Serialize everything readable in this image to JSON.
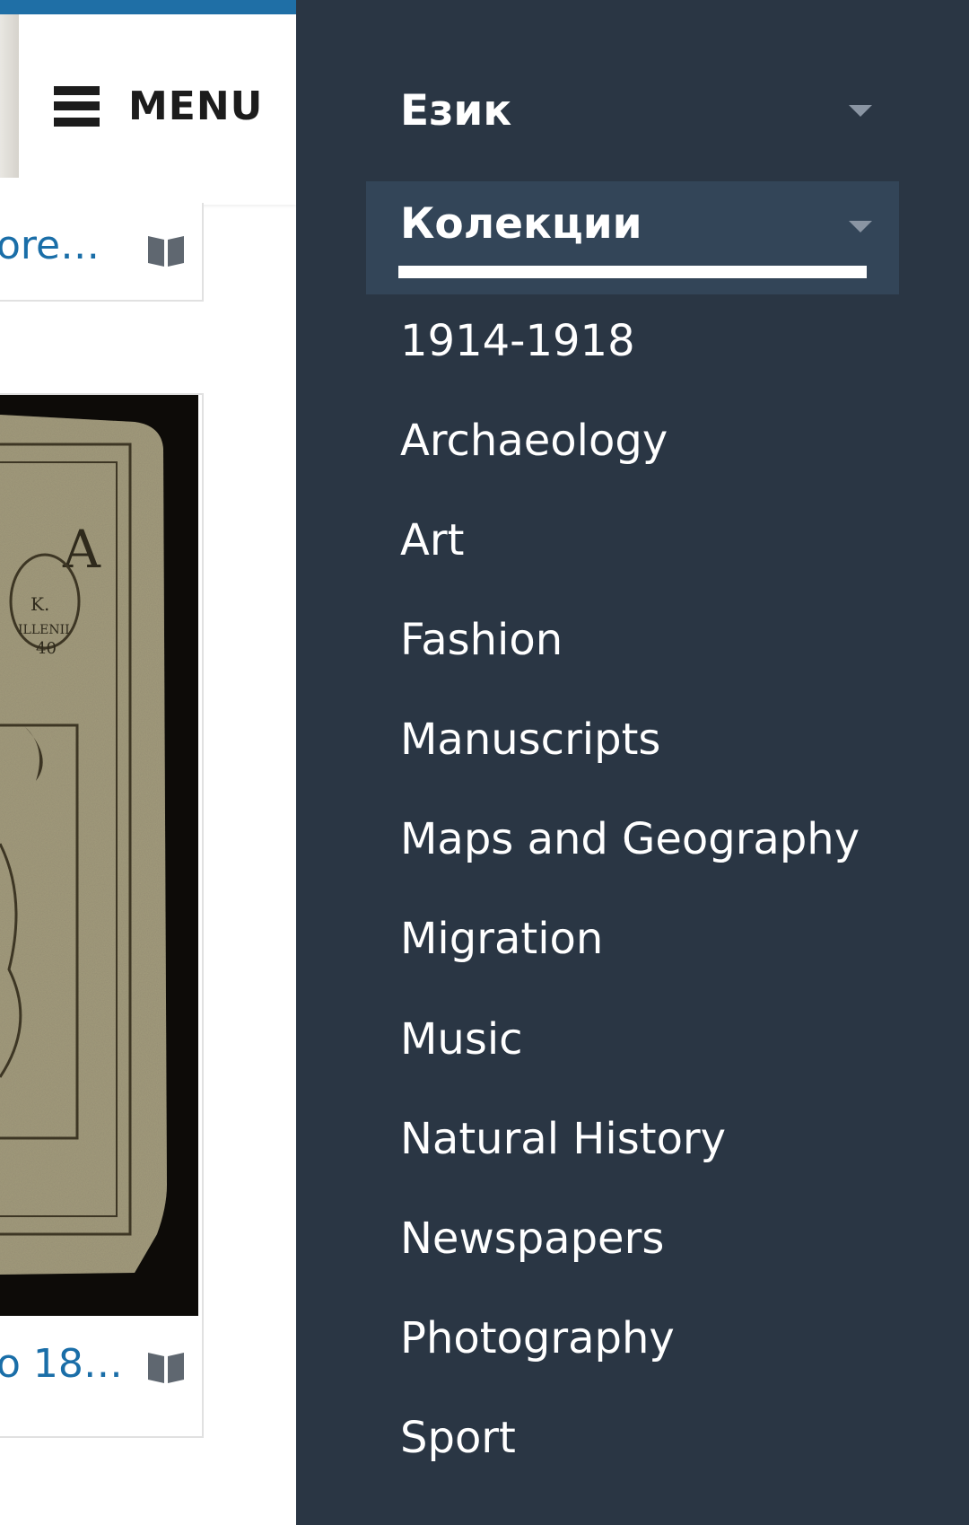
{
  "header": {
    "menu_label": "MENU",
    "menu_icon": "hamburger-icon"
  },
  "cards": [
    {
      "title": "ore…",
      "icon": "book-icon"
    },
    {
      "title": "o 18…",
      "icon": "book-icon"
    }
  ],
  "drawer": {
    "language_label": "Език",
    "collections_label": "Колекции",
    "collections": [
      "1914-1918",
      "Archaeology",
      "Art",
      "Fashion",
      "Manuscripts",
      "Maps and Geography",
      "Migration",
      "Music",
      "Natural History",
      "Newspapers",
      "Photography",
      "Sport"
    ]
  },
  "colors": {
    "drawer_bg": "#2a3644",
    "active_row_bg": "#334558",
    "link": "#1a6ea8",
    "brand_bar": "#1f6fa6"
  }
}
